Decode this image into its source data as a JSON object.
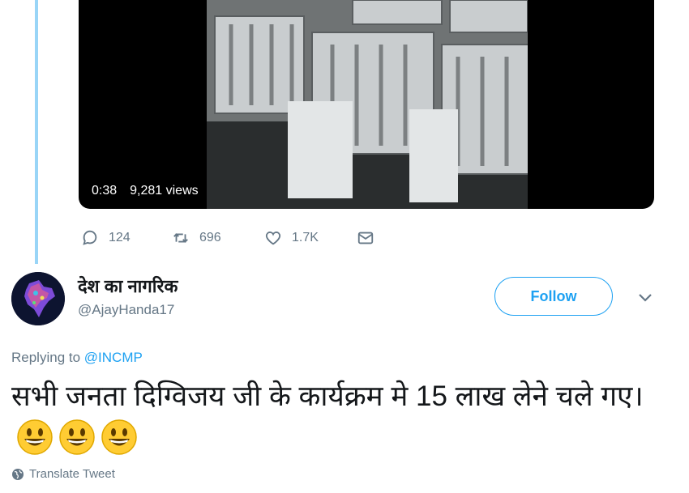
{
  "video": {
    "duration": "0:38",
    "views": "9,281 views"
  },
  "actions": {
    "reply_count": "124",
    "retweet_count": "696",
    "like_count": "1.7K"
  },
  "reply_tweet": {
    "display_name": "देश का नागरिक",
    "handle": "@AjayHanda17",
    "follow_label": "Follow",
    "replying_prefix": "Replying to",
    "replying_mention": "@INCMP",
    "text": "सभी जनता दिग्विजय जी के कार्यक्रम मे 15 लाख लेने चले गए।",
    "translate_label": "Translate Tweet"
  },
  "colors": {
    "accent": "#1da1f2",
    "muted": "#657786",
    "thread_line": "#99d5f7"
  },
  "icons": [
    "reply-icon",
    "retweet-icon",
    "like-icon",
    "message-icon",
    "chevron-down-icon",
    "globe-icon",
    "grinning-face-emoji"
  ]
}
